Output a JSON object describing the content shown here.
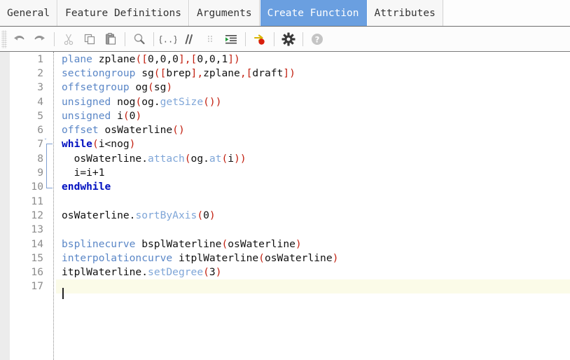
{
  "tabs": [
    {
      "label": "General",
      "active": false
    },
    {
      "label": "Feature Definitions",
      "active": false
    },
    {
      "label": "Arguments",
      "active": false
    },
    {
      "label": "Create Function",
      "active": true
    },
    {
      "label": "Attributes",
      "active": false
    }
  ],
  "toolbar": {
    "buttons": [
      {
        "name": "undo-icon",
        "title": "Undo",
        "enabled": true
      },
      {
        "name": "redo-icon",
        "title": "Redo",
        "enabled": true
      },
      {
        "name": "cut-icon",
        "title": "Cut",
        "enabled": false
      },
      {
        "name": "copy-icon",
        "title": "Copy",
        "enabled": true
      },
      {
        "name": "paste-icon",
        "title": "Paste",
        "enabled": true
      },
      {
        "name": "search-icon",
        "title": "Find",
        "enabled": true
      },
      {
        "name": "braces-icon",
        "title": "{..}",
        "enabled": true
      },
      {
        "name": "comment-icon",
        "title": "//",
        "enabled": true
      },
      {
        "name": "uncomment-icon",
        "title": "Uncomment",
        "enabled": false
      },
      {
        "name": "indent-icon",
        "title": "Indent",
        "enabled": true
      },
      {
        "name": "run-icon",
        "title": "Run",
        "enabled": true
      },
      {
        "name": "settings-gear-icon",
        "title": "Settings",
        "enabled": true
      },
      {
        "name": "help-icon",
        "title": "Help",
        "enabled": false
      }
    ]
  },
  "editor": {
    "current_line": 17,
    "fold_start_line": 7,
    "fold_end_line": 10,
    "colors": {
      "keyword": "#5b87c7",
      "control": "#0010c0",
      "method": "#7fa6d8",
      "punct": "#c21f0f",
      "identifier": "#111111",
      "current_line_bg": "#fbfbe8",
      "gutter_text": "#8c8c8c",
      "active_tab_bg": "#6a9fe0"
    },
    "lines": [
      {
        "n": "1",
        "text": "plane zplane([0,0,0],[0,0,1])"
      },
      {
        "n": "2",
        "text": "sectiongroup sg([brep],zplane,[draft])"
      },
      {
        "n": "3",
        "text": "offsetgroup og(sg)"
      },
      {
        "n": "4",
        "text": "unsigned nog(og.getSize())"
      },
      {
        "n": "5",
        "text": "unsigned i(0)"
      },
      {
        "n": "6",
        "text": "offset osWaterline()"
      },
      {
        "n": "7",
        "text": "while(i<nog)"
      },
      {
        "n": "8",
        "text": "  osWaterline.attach(og.at(i))"
      },
      {
        "n": "9",
        "text": "  i=i+1"
      },
      {
        "n": "10",
        "text": "endwhile"
      },
      {
        "n": "11",
        "text": ""
      },
      {
        "n": "12",
        "text": "osWaterline.sortByAxis(0)"
      },
      {
        "n": "13",
        "text": ""
      },
      {
        "n": "14",
        "text": "bsplinecurve bsplWaterline(osWaterline)"
      },
      {
        "n": "15",
        "text": "interpolationcurve itplWaterline(osWaterline)"
      },
      {
        "n": "16",
        "text": "itplWaterline.setDegree(3)"
      },
      {
        "n": "17",
        "text": ""
      }
    ],
    "tokens": [
      [
        {
          "t": "plane",
          "c": "kw"
        },
        {
          "t": " zplane",
          "c": "id"
        },
        {
          "t": "([",
          "c": "pn"
        },
        {
          "t": "0,0,0",
          "c": "id"
        },
        {
          "t": "],[",
          "c": "pn"
        },
        {
          "t": "0,0,1",
          "c": "id"
        },
        {
          "t": "])",
          "c": "pn"
        }
      ],
      [
        {
          "t": "sectiongroup",
          "c": "kw"
        },
        {
          "t": " sg",
          "c": "id"
        },
        {
          "t": "([",
          "c": "pn"
        },
        {
          "t": "brep",
          "c": "id"
        },
        {
          "t": "],",
          "c": "pn"
        },
        {
          "t": "zplane",
          "c": "id"
        },
        {
          "t": ",",
          "c": "pn"
        },
        {
          "t": "[",
          "c": "pn"
        },
        {
          "t": "draft",
          "c": "id"
        },
        {
          "t": "])",
          "c": "pn"
        }
      ],
      [
        {
          "t": "offsetgroup",
          "c": "kw"
        },
        {
          "t": " og",
          "c": "id"
        },
        {
          "t": "(",
          "c": "pn"
        },
        {
          "t": "sg",
          "c": "id"
        },
        {
          "t": ")",
          "c": "pn"
        }
      ],
      [
        {
          "t": "unsigned",
          "c": "kw"
        },
        {
          "t": " nog",
          "c": "id"
        },
        {
          "t": "(",
          "c": "pn"
        },
        {
          "t": "og",
          "c": "id"
        },
        {
          "t": ".",
          "c": "id"
        },
        {
          "t": "getSize",
          "c": "mth"
        },
        {
          "t": "())",
          "c": "pn"
        }
      ],
      [
        {
          "t": "unsigned",
          "c": "kw"
        },
        {
          "t": " i",
          "c": "id"
        },
        {
          "t": "(",
          "c": "pn"
        },
        {
          "t": "0",
          "c": "id"
        },
        {
          "t": ")",
          "c": "pn"
        }
      ],
      [
        {
          "t": "offset",
          "c": "kw"
        },
        {
          "t": " osWaterline",
          "c": "id"
        },
        {
          "t": "()",
          "c": "pn"
        }
      ],
      [
        {
          "t": "while",
          "c": "ctl"
        },
        {
          "t": "(",
          "c": "pn"
        },
        {
          "t": "i<nog",
          "c": "id"
        },
        {
          "t": ")",
          "c": "pn"
        }
      ],
      [
        {
          "t": "  osWaterline",
          "c": "id"
        },
        {
          "t": ".",
          "c": "id"
        },
        {
          "t": "attach",
          "c": "mth"
        },
        {
          "t": "(",
          "c": "pn"
        },
        {
          "t": "og",
          "c": "id"
        },
        {
          "t": ".",
          "c": "id"
        },
        {
          "t": "at",
          "c": "mth"
        },
        {
          "t": "(",
          "c": "pn"
        },
        {
          "t": "i",
          "c": "id"
        },
        {
          "t": "))",
          "c": "pn"
        }
      ],
      [
        {
          "t": "  i=i+1",
          "c": "id"
        }
      ],
      [
        {
          "t": "endwhile",
          "c": "ctl"
        }
      ],
      [],
      [
        {
          "t": "osWaterline",
          "c": "id"
        },
        {
          "t": ".",
          "c": "id"
        },
        {
          "t": "sortByAxis",
          "c": "mth"
        },
        {
          "t": "(",
          "c": "pn"
        },
        {
          "t": "0",
          "c": "id"
        },
        {
          "t": ")",
          "c": "pn"
        }
      ],
      [],
      [
        {
          "t": "bsplinecurve",
          "c": "kw"
        },
        {
          "t": " bsplWaterline",
          "c": "id"
        },
        {
          "t": "(",
          "c": "pn"
        },
        {
          "t": "osWaterline",
          "c": "id"
        },
        {
          "t": ")",
          "c": "pn"
        }
      ],
      [
        {
          "t": "interpolationcurve",
          "c": "kw"
        },
        {
          "t": " itplWaterline",
          "c": "id"
        },
        {
          "t": "(",
          "c": "pn"
        },
        {
          "t": "osWaterline",
          "c": "id"
        },
        {
          "t": ")",
          "c": "pn"
        }
      ],
      [
        {
          "t": "itplWaterline",
          "c": "id"
        },
        {
          "t": ".",
          "c": "id"
        },
        {
          "t": "setDegree",
          "c": "mth"
        },
        {
          "t": "(",
          "c": "pn"
        },
        {
          "t": "3",
          "c": "id"
        },
        {
          "t": ")",
          "c": "pn"
        }
      ],
      []
    ]
  }
}
